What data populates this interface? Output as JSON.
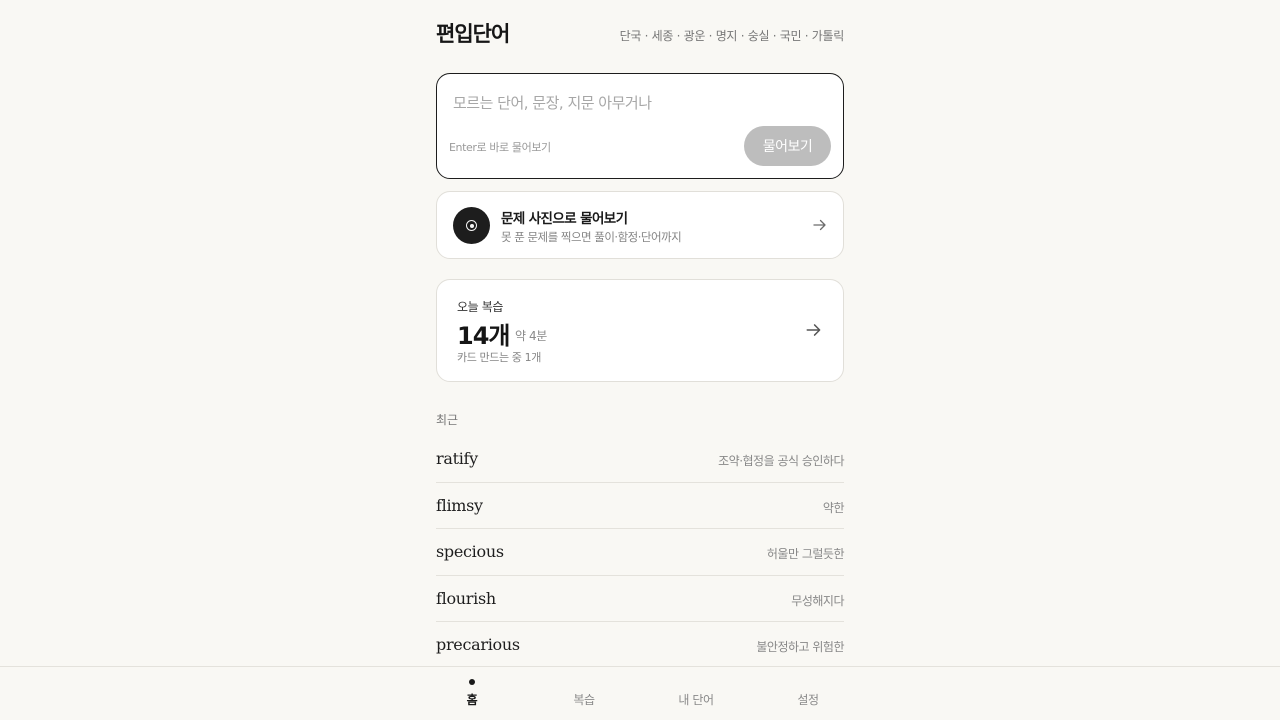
{
  "header": {
    "brand": "편입단어",
    "schools": "단국 · 세종 · 광운 · 명지 · 숭실 · 국민 · 가톨릭"
  },
  "ask": {
    "placeholder": "모르는 단어, 문장, 지문 아무거나",
    "value": "",
    "hint": "Enter로 바로 물어보기",
    "button_label": "물어보기"
  },
  "photo_card": {
    "icon": "camera-icon",
    "title": "문제 사진으로 물어보기",
    "subtitle": "못 푼 문제를 찍으면 풀이·함정·단어까지"
  },
  "review_card": {
    "label": "오늘 복습",
    "count": "14개",
    "time": "약 4분",
    "note": "카드 만드는 중 1개"
  },
  "recent": {
    "label": "최근",
    "items": [
      {
        "word": "ratify",
        "meaning": "조약·협정을 공식 승인하다"
      },
      {
        "word": "flimsy",
        "meaning": "약한"
      },
      {
        "word": "specious",
        "meaning": "허울만 그럴듯한"
      },
      {
        "word": "flourish",
        "meaning": "무성해지다"
      },
      {
        "word": "precarious",
        "meaning": "불안정하고 위험한"
      }
    ]
  },
  "tabs": [
    {
      "label": "홈",
      "active": true
    },
    {
      "label": "복습",
      "active": false
    },
    {
      "label": "내 단어",
      "active": false
    },
    {
      "label": "설정",
      "active": false
    }
  ],
  "colors": {
    "background": "#f9f8f4",
    "accent_dark": "#1d1d1d",
    "button_disabled": "#bdbdbd"
  }
}
